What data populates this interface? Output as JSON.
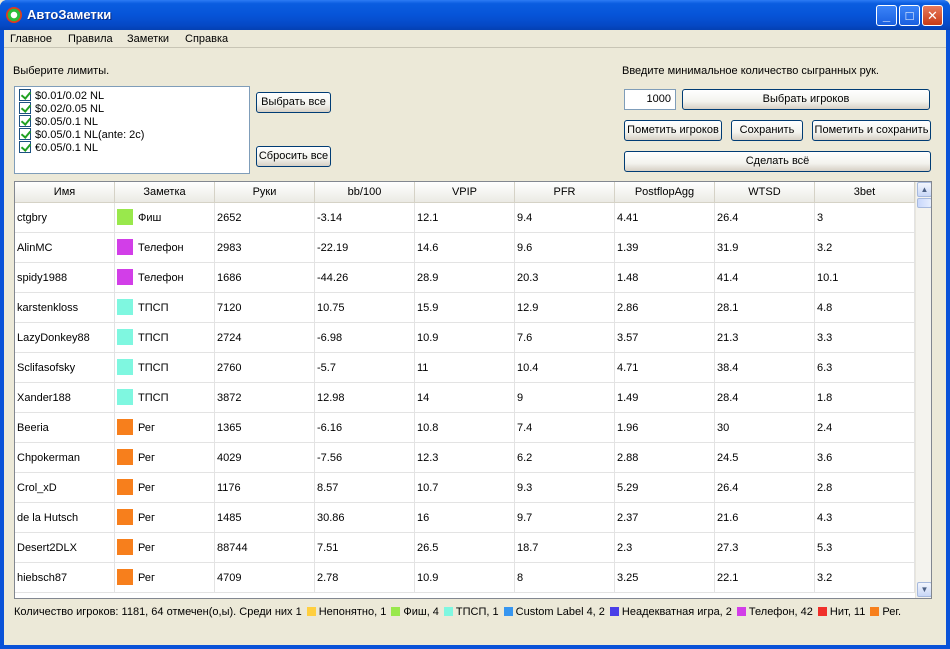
{
  "window": {
    "title": "АвтоЗаметки"
  },
  "menu": [
    "Главное",
    "Правила",
    "Заметки",
    "Справка"
  ],
  "limits": {
    "label": "Выберите лимиты.",
    "items": [
      "$0.01/0.02 NL",
      "$0.02/0.05 NL",
      "$0.05/0.1 NL",
      "$0.05/0.1 NL(ante: 2c)",
      "€0.05/0.1 NL"
    ],
    "select_all_label": "Выбрать все",
    "reset_all_label": "Сбросить все"
  },
  "hands": {
    "label": "Введите минимальное количество сыгранных рук.",
    "value": "1000",
    "select_players_label": "Выбрать игроков",
    "mark_players_label": "Пометить игроков",
    "save_label": "Сохранить",
    "mark_and_save_label": "Пометить и сохранить",
    "do_all_label": "Сделать всё"
  },
  "table": {
    "columns": [
      "Имя",
      "Заметка",
      "Руки",
      "bb/100",
      "VPIP",
      "PFR",
      "PostflopAgg",
      "WTSD",
      "3bet"
    ],
    "rows": [
      {
        "name": "ctgbry",
        "note": "Фиш",
        "color": "#99e84c",
        "hands": "2652",
        "bb100": "-3.14",
        "vpip": "12.1",
        "pfr": "9.4",
        "agg": "4.41",
        "wtsd": "26.4",
        "threebet": "3"
      },
      {
        "name": "AlinMC",
        "note": "Телефон",
        "color": "#d23ee8",
        "hands": "2983",
        "bb100": "-22.19",
        "vpip": "14.6",
        "pfr": "9.6",
        "agg": "1.39",
        "wtsd": "31.9",
        "threebet": "3.2"
      },
      {
        "name": "spidy1988",
        "note": "Телефон",
        "color": "#d23ee8",
        "hands": "1686",
        "bb100": "-44.26",
        "vpip": "28.9",
        "pfr": "20.3",
        "agg": "1.48",
        "wtsd": "41.4",
        "threebet": "10.1"
      },
      {
        "name": "karstenkloss",
        "note": "ТПСП",
        "color": "#7ff7e0",
        "hands": "7120",
        "bb100": "10.75",
        "vpip": "15.9",
        "pfr": "12.9",
        "agg": "2.86",
        "wtsd": "28.1",
        "threebet": "4.8"
      },
      {
        "name": "LazyDonkey88",
        "note": "ТПСП",
        "color": "#7ff7e0",
        "hands": "2724",
        "bb100": "-6.98",
        "vpip": "10.9",
        "pfr": "7.6",
        "agg": "3.57",
        "wtsd": "21.3",
        "threebet": "3.3"
      },
      {
        "name": "Sclifasofsky",
        "note": "ТПСП",
        "color": "#7ff7e0",
        "hands": "2760",
        "bb100": "-5.7",
        "vpip": "11",
        "pfr": "10.4",
        "agg": "4.71",
        "wtsd": "38.4",
        "threebet": "6.3"
      },
      {
        "name": "Xander188",
        "note": "ТПСП",
        "color": "#7ff7e0",
        "hands": "3872",
        "bb100": "12.98",
        "vpip": "14",
        "pfr": "9",
        "agg": "1.49",
        "wtsd": "28.4",
        "threebet": "1.8"
      },
      {
        "name": "Beeria",
        "note": "Рег",
        "color": "#f77f1c",
        "hands": "1365",
        "bb100": "-6.16",
        "vpip": "10.8",
        "pfr": "7.4",
        "agg": "1.96",
        "wtsd": "30",
        "threebet": "2.4"
      },
      {
        "name": "Chpokerman",
        "note": "Рег",
        "color": "#f77f1c",
        "hands": "4029",
        "bb100": "-7.56",
        "vpip": "12.3",
        "pfr": "6.2",
        "agg": "2.88",
        "wtsd": "24.5",
        "threebet": "3.6"
      },
      {
        "name": "Crol_xD",
        "note": "Рег",
        "color": "#f77f1c",
        "hands": "1176",
        "bb100": "8.57",
        "vpip": "10.7",
        "pfr": "9.3",
        "agg": "5.29",
        "wtsd": "26.4",
        "threebet": "2.8"
      },
      {
        "name": "de la Hutsch",
        "note": "Рег",
        "color": "#f77f1c",
        "hands": "1485",
        "bb100": "30.86",
        "vpip": "16",
        "pfr": "9.7",
        "agg": "2.37",
        "wtsd": "21.6",
        "threebet": "4.3"
      },
      {
        "name": "Desert2DLX",
        "note": "Рег",
        "color": "#f77f1c",
        "hands": "88744",
        "bb100": "7.51",
        "vpip": "26.5",
        "pfr": "18.7",
        "agg": "2.3",
        "wtsd": "27.3",
        "threebet": "5.3"
      },
      {
        "name": "hiebsch87",
        "note": "Рег",
        "color": "#f77f1c",
        "hands": "4709",
        "bb100": "2.78",
        "vpip": "10.9",
        "pfr": "8",
        "agg": "3.25",
        "wtsd": "22.1",
        "threebet": "3.2"
      }
    ]
  },
  "status": {
    "prefix": "Количество игроков: 1181, 64 отмечен(о,ы). Среди них 1",
    "legend": [
      {
        "color": "#ffcf3f",
        "text": "Непонятно, 1"
      },
      {
        "color": "#99e84c",
        "text": "Фиш, 4"
      },
      {
        "color": "#7ff7e0",
        "text": "ТПСП, 1"
      },
      {
        "color": "#3796f0",
        "text": "Custom Label 4, 2"
      },
      {
        "color": "#4a3fe8",
        "text": "Неадекватная игра, 2"
      },
      {
        "color": "#d23ee8",
        "text": "Телефон, 42"
      },
      {
        "color": "#f0302a",
        "text": "Нит, 11"
      },
      {
        "color": "#f77f1c",
        "text": "Рег."
      }
    ]
  }
}
